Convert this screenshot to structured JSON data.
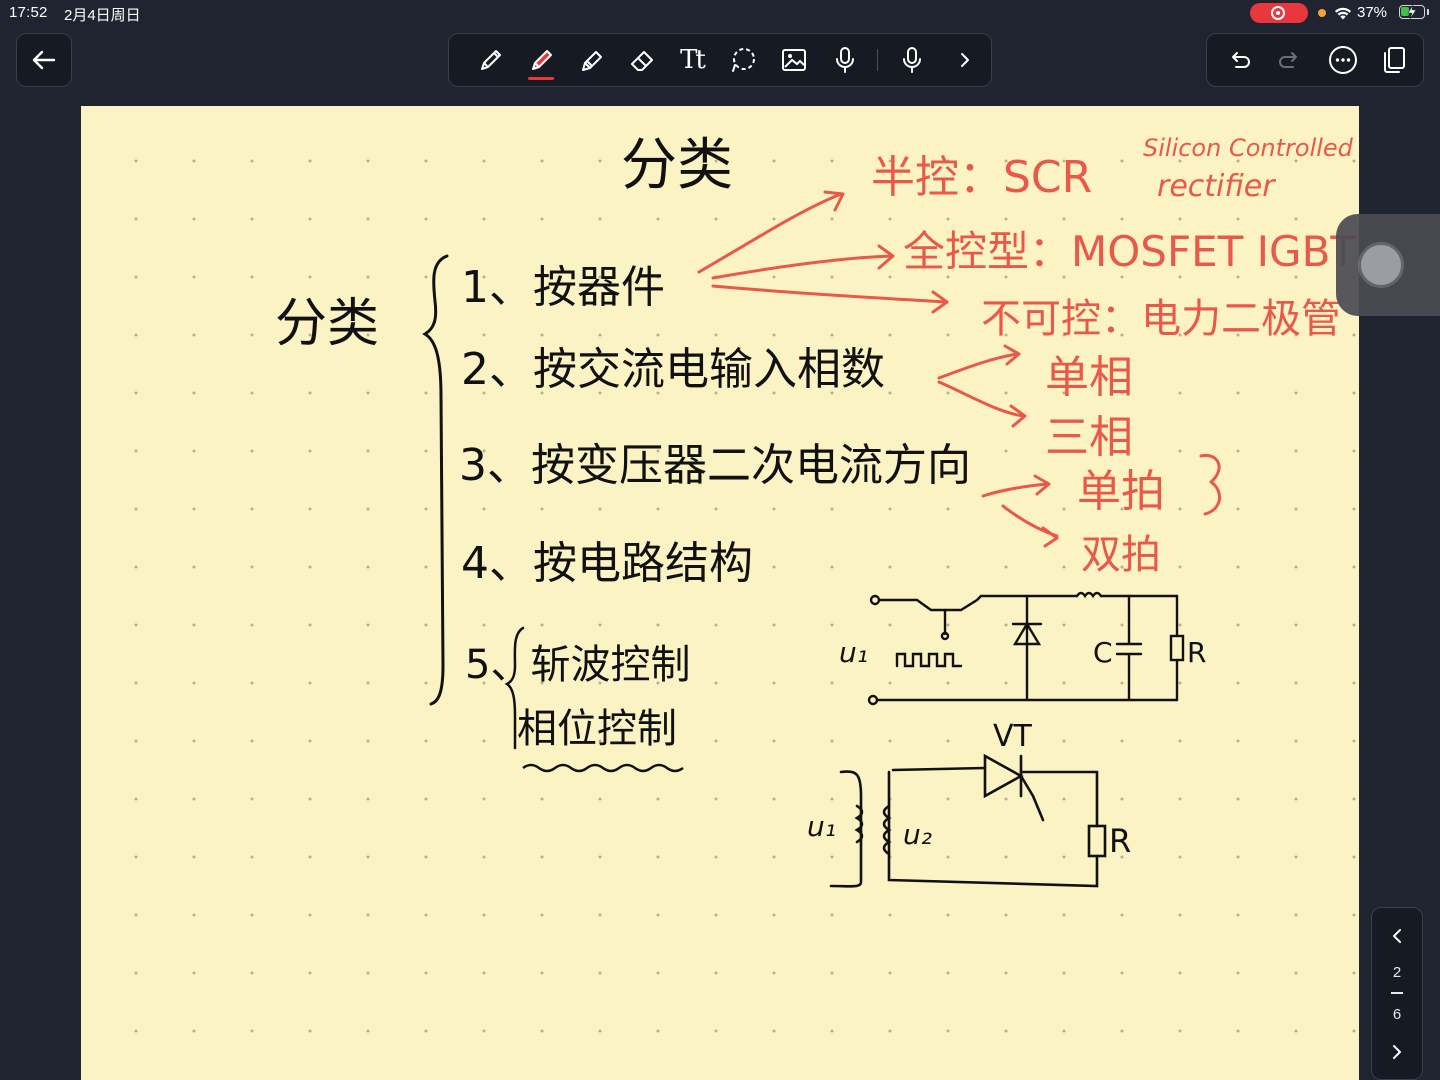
{
  "status_bar": {
    "time": "17:52",
    "date": "2月4日周日",
    "battery_percent": "37%",
    "battery_level": 0.37,
    "recording": true
  },
  "toolbar": {
    "tools": [
      {
        "id": "pen",
        "icon": "pen-icon"
      },
      {
        "id": "highlighter",
        "icon": "highlighter-icon",
        "active": true,
        "color": "#e8383d"
      },
      {
        "id": "pencil",
        "icon": "pencil-icon"
      },
      {
        "id": "eraser",
        "icon": "eraser-icon"
      },
      {
        "id": "text",
        "icon": "text-icon"
      },
      {
        "id": "lasso",
        "icon": "lasso-icon"
      },
      {
        "id": "image",
        "icon": "image-icon"
      },
      {
        "id": "audio",
        "icon": "microphone-icon"
      },
      {
        "id": "record",
        "icon": "microphone-icon"
      },
      {
        "id": "more-tools",
        "icon": "chevron-right-icon"
      }
    ],
    "text_tool_label": "Tt"
  },
  "right_toolbar": {
    "icons": [
      "undo-icon",
      "redo-icon",
      "more-icon",
      "pages-icon"
    ]
  },
  "page_nav": {
    "current": "2",
    "total": "6"
  },
  "note": {
    "ink_black": "#111111",
    "ink_red": "#e8594a",
    "paper_color": "#fbf3c4",
    "title": "分类",
    "left_label": "分类",
    "items": [
      "1、按器件",
      "2、按交流电输入相数",
      "3、按变压器二次电流方向",
      "4、按电路结构",
      "5、斩波控制",
      "相位控制"
    ],
    "annotations": {
      "semi_controlled": "半控：SCR",
      "scr_full": "Silicon Controlled",
      "scr_full_2": "rectifier",
      "full_controlled": "全控型：MOSFET IGBT",
      "uncontrolled": "不可控：电力二极管",
      "single_phase": "单相",
      "three_phase": "三相",
      "single_beat": "单拍",
      "double_beat": "双拍"
    },
    "circuit_labels": {
      "u1_top": "u₁",
      "c": "C",
      "r_top": "R",
      "vt": "VT",
      "u1_bottom": "u₁",
      "u2": "u₂",
      "r_bottom": "R"
    }
  }
}
